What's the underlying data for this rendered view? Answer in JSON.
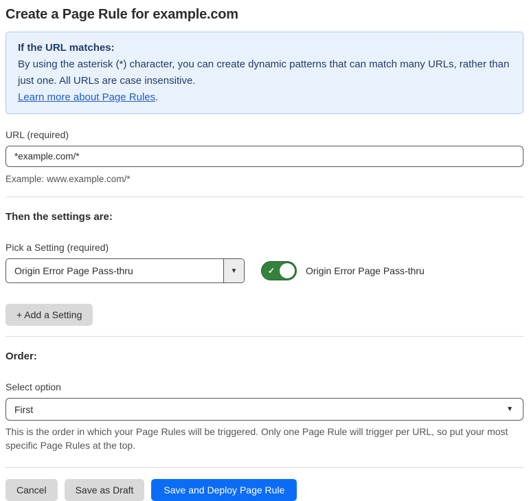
{
  "page": {
    "title": "Create a Page Rule for example.com"
  },
  "info_box": {
    "heading": "If the URL matches:",
    "body": "By using the asterisk (*) character, you can create dynamic patterns that can match many URLs, rather than just one. All URLs are case insensitive.",
    "link": "Learn more about Page Rules",
    "link_suffix": "."
  },
  "url_field": {
    "label": "URL (required)",
    "value": "*example.com/*",
    "helper": "Example: www.example.com/*"
  },
  "settings_section": {
    "heading": "Then the settings are:",
    "pick_label": "Pick a Setting (required)",
    "selected_setting": "Origin Error Page Pass-thru",
    "toggle_state": "on",
    "toggle_label": "Origin Error Page Pass-thru",
    "add_button": "+ Add a Setting"
  },
  "order_section": {
    "heading": "Order:",
    "label": "Select option",
    "selected_option": "First",
    "helper": "This is the order in which your Page Rules will be triggered. Only one Page Rule will trigger per URL, so put your most specific Page Rules at the top."
  },
  "footer": {
    "cancel": "Cancel",
    "save_draft": "Save as Draft",
    "save_deploy": "Save and Deploy Page Rule"
  },
  "icons": {
    "dropdown_caret": "▼",
    "toggle_check": "✓"
  },
  "colors": {
    "accent_blue": "#0b6df6",
    "info_bg": "#e9f2fc",
    "info_border": "#abc9ee",
    "info_text": "#1e3c6d",
    "link_blue": "#1f5cc4",
    "toggle_green": "#35823f",
    "toggle_green_border": "#23602e"
  }
}
